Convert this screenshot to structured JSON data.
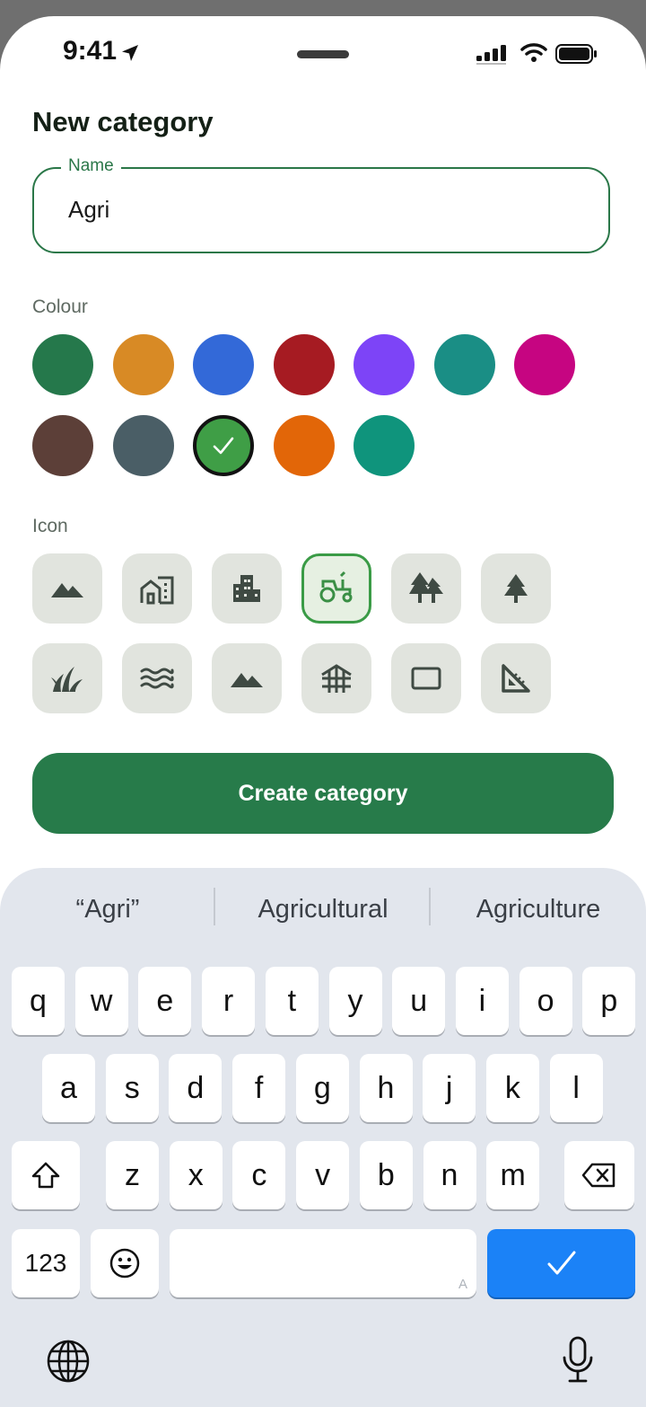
{
  "status_bar": {
    "time": "9:41"
  },
  "page": {
    "title": "New category"
  },
  "name_field": {
    "label": "Name",
    "value": "Agri"
  },
  "colour_section": {
    "label": "Colour",
    "swatches": [
      {
        "color": "#25784b",
        "selected": false
      },
      {
        "color": "#d88a25",
        "selected": false
      },
      {
        "color": "#3369d8",
        "selected": false
      },
      {
        "color": "#a61b22",
        "selected": false
      },
      {
        "color": "#7d44f7",
        "selected": false
      },
      {
        "color": "#1a8e85",
        "selected": false
      },
      {
        "color": "#c60581",
        "selected": false
      },
      {
        "color": "#5c3f38",
        "selected": false
      },
      {
        "color": "#4a5e66",
        "selected": false
      },
      {
        "color": "#3f9e46",
        "selected": true
      },
      {
        "color": "#e26608",
        "selected": false
      },
      {
        "color": "#0f947c",
        "selected": false
      }
    ]
  },
  "icon_section": {
    "label": "Icon",
    "icons": [
      {
        "name": "landscape-icon",
        "selected": false
      },
      {
        "name": "house-building-icon",
        "selected": false
      },
      {
        "name": "apartment-icon",
        "selected": false
      },
      {
        "name": "tractor-icon",
        "selected": true
      },
      {
        "name": "forest-icon",
        "selected": false
      },
      {
        "name": "tree-icon",
        "selected": false
      },
      {
        "name": "grass-icon",
        "selected": false
      },
      {
        "name": "waves-icon",
        "selected": false
      },
      {
        "name": "mountain-icon",
        "selected": false
      },
      {
        "name": "fence-icon",
        "selected": false
      },
      {
        "name": "rectangle-icon",
        "selected": false
      },
      {
        "name": "set-square-icon",
        "selected": false
      }
    ]
  },
  "create_button": {
    "label": "Create category"
  },
  "keyboard": {
    "suggestions": [
      "“Agri”",
      "Agricultural",
      "Agriculture"
    ],
    "row1": [
      "q",
      "w",
      "e",
      "r",
      "t",
      "y",
      "u",
      "i",
      "o",
      "p"
    ],
    "row2": [
      "a",
      "s",
      "d",
      "f",
      "g",
      "h",
      "j",
      "k",
      "l"
    ],
    "row3": [
      "z",
      "x",
      "c",
      "v",
      "b",
      "n",
      "m"
    ],
    "numbers_key": "123",
    "space_hint": "A"
  },
  "colors": {
    "accent": "#277b4a",
    "outline": "#2a7748",
    "return_key": "#1b82f7"
  }
}
